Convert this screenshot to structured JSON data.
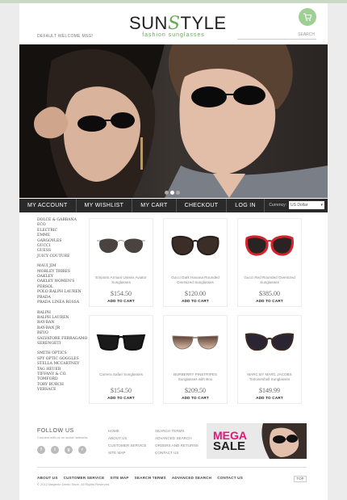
{
  "header": {
    "logo_main_a": "SUN",
    "logo_main_b": "S",
    "logo_main_c": "TYLE",
    "logo_sub": "fashion sunglasses",
    "welcome": "DEFAULT WELCOME MSG!",
    "search_placeholder": "SEARCH",
    "accent": "#66a85a"
  },
  "nav": {
    "items": [
      "MY ACCOUNT",
      "MY WISHLIST",
      "MY CART",
      "CHECKOUT",
      "LOG IN"
    ],
    "currency_label": "Currency:",
    "currency_value": "US Dollar"
  },
  "sidebar": {
    "groups": [
      [
        "DOLCE & GABBANA",
        "ECO",
        "ELECTRIC",
        "EMME",
        "GARGOYLES",
        "GUCCI",
        "GUESS",
        "JUICY COUTURE"
      ],
      [
        "MAUI JIM",
        "MORLEY TRIBES",
        "OAKLEY",
        "OAKLEY WOMEN'S",
        "PERSOL",
        "POLO RALPH LAUREN",
        "PRADA",
        "PRADA LINEA ROSSA"
      ],
      [
        "RALPH",
        "RALPH LAUREN",
        "RAY-BAN",
        "RAY-BAN JR",
        "REVO",
        "SALVATORE FERRAGAMO",
        "SERENGETI"
      ],
      [
        "SMITH OPTICS",
        "SPY OPTIC GOGGLES",
        "STELLA MCCARTNEY",
        "TAG HEUER",
        "TIFFANY & CO.",
        "TOMFORD",
        "TORY BURCH",
        "VERSACE"
      ]
    ]
  },
  "products": [
    {
      "name": "Emporio Armani Unisex Aviator Sunglasses",
      "price": "$154.50",
      "add": "ADD TO CART",
      "icon": "aviator-sunglasses"
    },
    {
      "name": "Gucci Dark Havana Rounded Oversized Sunglasses",
      "price": "$120.00",
      "add": "ADD TO CART",
      "icon": "oversized-sunglasses"
    },
    {
      "name": "Gucci Red Rounded Oversized Sunglasses",
      "price": "$385.00",
      "add": "ADD TO CART",
      "icon": "red-sunglasses"
    },
    {
      "name": "Carrera Safari Sunglasses",
      "price": "$154.50",
      "add": "ADD TO CART",
      "icon": "wayfarer-sunglasses"
    },
    {
      "name": "BURBERRY PINSTRIPES Sunglasses with Box",
      "price": "$209.50",
      "add": "ADD TO CART",
      "icon": "gradient-sunglasses"
    },
    {
      "name": "MARC BY MARC JACOBS Tortoiseshell Sunglasses",
      "price": "$149.99",
      "add": "ADD TO CART",
      "icon": "cat-eye-sunglasses"
    }
  ],
  "footer": {
    "follow": "FOLLOW US",
    "follow_sub": "Connect with us on social networks",
    "col1": [
      "HOME",
      "ABOUT US",
      "CUSTOMER SERVICE",
      "SITE MAP"
    ],
    "col2": [
      "SEARCH TERMS",
      "ADVANCED SEARCH",
      "ORDERS AND RETURNS",
      "CONTACT US"
    ],
    "sale_mega": "MEGA",
    "sale_sale": "SALE",
    "bottom_links": [
      "ABOUT US",
      "CUSTOMER SERVICE",
      "SITE MAP",
      "SEARCH TERMS",
      "ADVANCED SEARCH",
      "CONTACT US"
    ],
    "copyright": "© 2013 Magento Demo Store. All Rights Reserved.",
    "top": "TOP"
  }
}
